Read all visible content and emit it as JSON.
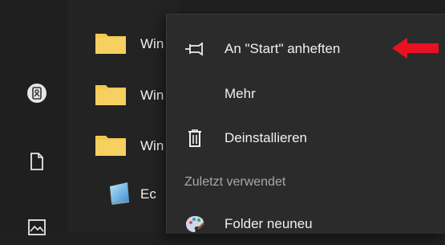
{
  "colors": {
    "background": "#202020",
    "menu_bg": "#2b2b2b",
    "folder": "#f2c94c",
    "arrow": "#e81123"
  },
  "rail": {
    "icons": [
      "user-badge-icon",
      "document-icon",
      "image-icon"
    ]
  },
  "app_list": {
    "items": [
      {
        "label": "Win",
        "icon": "folder-icon"
      },
      {
        "label": "Win",
        "icon": "folder-icon"
      },
      {
        "label": "Win",
        "icon": "folder-icon"
      },
      {
        "label": "Ec",
        "icon": "app-tile-icon"
      }
    ]
  },
  "context_menu": {
    "items": [
      {
        "label": "An \"Start\" anheften",
        "icon": "pin-icon"
      },
      {
        "label": "Mehr",
        "icon": ""
      },
      {
        "label": "Deinstallieren",
        "icon": "trash-icon"
      }
    ],
    "recent_header": "Zuletzt verwendet",
    "recent_items": [
      {
        "label": "Folder neuneu",
        "icon": "paint-palette-icon"
      }
    ]
  }
}
